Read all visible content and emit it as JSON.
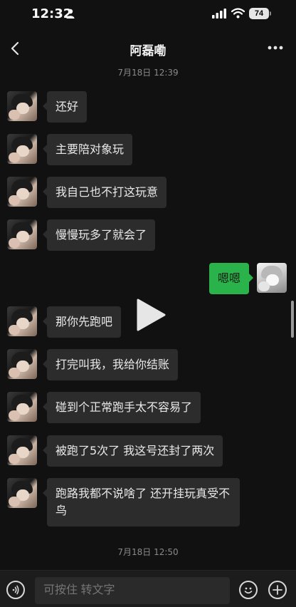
{
  "status": {
    "time": "12:32",
    "battery": "74"
  },
  "header": {
    "title": "阿磊嘞"
  },
  "timestamps": {
    "top": "7月18日 12:39",
    "bottom": "7月18日 12:50"
  },
  "messages": [
    {
      "from": "them",
      "text": "还好"
    },
    {
      "from": "them",
      "text": "主要陪对象玩"
    },
    {
      "from": "them",
      "text": "我自己也不打这玩意"
    },
    {
      "from": "them",
      "text": "慢慢玩多了就会了"
    },
    {
      "from": "me",
      "text": "嗯嗯"
    },
    {
      "from": "them",
      "text": "那你先跑吧"
    },
    {
      "from": "them",
      "text": "打完叫我，我给你结账"
    },
    {
      "from": "them",
      "text": "碰到个正常跑手太不容易了"
    },
    {
      "from": "them",
      "text": "被跑了5次了 我这号还封了两次"
    },
    {
      "from": "them",
      "text": "跑路我都不说啥了 还开挂玩真受不鸟"
    }
  ],
  "input": {
    "placeholder": "可按住 转文字"
  },
  "icons": {
    "back": "chevron-left-icon",
    "more": "more-icon",
    "voice": "voice-icon",
    "emoji": "emoji-icon",
    "plus": "plus-icon",
    "play": "play-icon"
  },
  "colors": {
    "background": "#111111",
    "bubble_them": "#2c2c2c",
    "bubble_me": "#2bb34b"
  }
}
